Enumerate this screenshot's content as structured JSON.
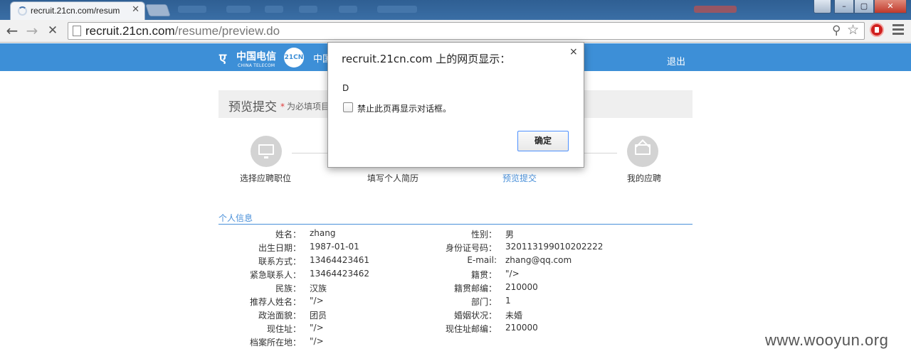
{
  "browser": {
    "tab_title": "recruit.21cn.com/resum",
    "tab_close": "✕",
    "url_host": "recruit.21cn.com",
    "url_path": "/resume/preview.do",
    "back_glyph": "←",
    "forward_glyph": "→",
    "stop_glyph": "✕",
    "zoom_glyph": "⚲",
    "star_glyph": "☆",
    "window_controls": {
      "minimize": "–",
      "maximize": "▢",
      "close": "✕"
    }
  },
  "header": {
    "logo_mark": "ए",
    "brand_cn": "中国电信",
    "brand_en": "CHINA TELECOM",
    "badge_21cn": "21CN",
    "title_partial": "中国",
    "logout": "退出"
  },
  "preview": {
    "title": "预览提交",
    "required_star": "*",
    "required_note": "为必填项目"
  },
  "steps": [
    {
      "label": "选择应聘职位",
      "icon": "monitor-icon",
      "active": false
    },
    {
      "label": "填写个人简历",
      "icon": "",
      "active": false
    },
    {
      "label": "预览提交",
      "icon": "",
      "active": true
    },
    {
      "label": "我的应聘",
      "icon": "mail-icon",
      "active": false
    }
  ],
  "personal_info": {
    "section_title": "个人信息",
    "left": [
      {
        "label": "姓名：",
        "value": "zhang"
      },
      {
        "label": "出生日期：",
        "value": "1987-01-01"
      },
      {
        "label": "联系方式：",
        "value": "13464423461"
      },
      {
        "label": "紧急联系人：",
        "value": "13464423462"
      },
      {
        "label": "民族：",
        "value": "汉族"
      },
      {
        "label": "推荐人姓名：",
        "value": "\"/>"
      },
      {
        "label": "政治面貌：",
        "value": "团员"
      },
      {
        "label": "现住址：",
        "value": "\"/>"
      },
      {
        "label": "档案所在地：",
        "value": "\"/>"
      }
    ],
    "right": [
      {
        "label": "性别：",
        "value": "男"
      },
      {
        "label": "身份证号码：",
        "value": "320113199010202222"
      },
      {
        "label": "E-mail:",
        "value": "zhang@qq.com"
      },
      {
        "label": "籍贯：",
        "value": "\"/>"
      },
      {
        "label": "籍贯邮编：",
        "value": "210000"
      },
      {
        "label": "部门：",
        "value": "1"
      },
      {
        "label": "婚姻状况：",
        "value": "未婚"
      },
      {
        "label": "现住址邮编：",
        "value": "210000"
      }
    ]
  },
  "dialog": {
    "title": "recruit.21cn.com 上的网页显示：",
    "close": "×",
    "message": "D",
    "checkbox_label": "禁止此页再显示对话框。",
    "ok": "确定"
  },
  "watermark": "www.wooyun.org",
  "colors": {
    "header_blue": "#3d8fd7",
    "link_blue": "#4a90d9",
    "required_red": "#e03c3c"
  }
}
